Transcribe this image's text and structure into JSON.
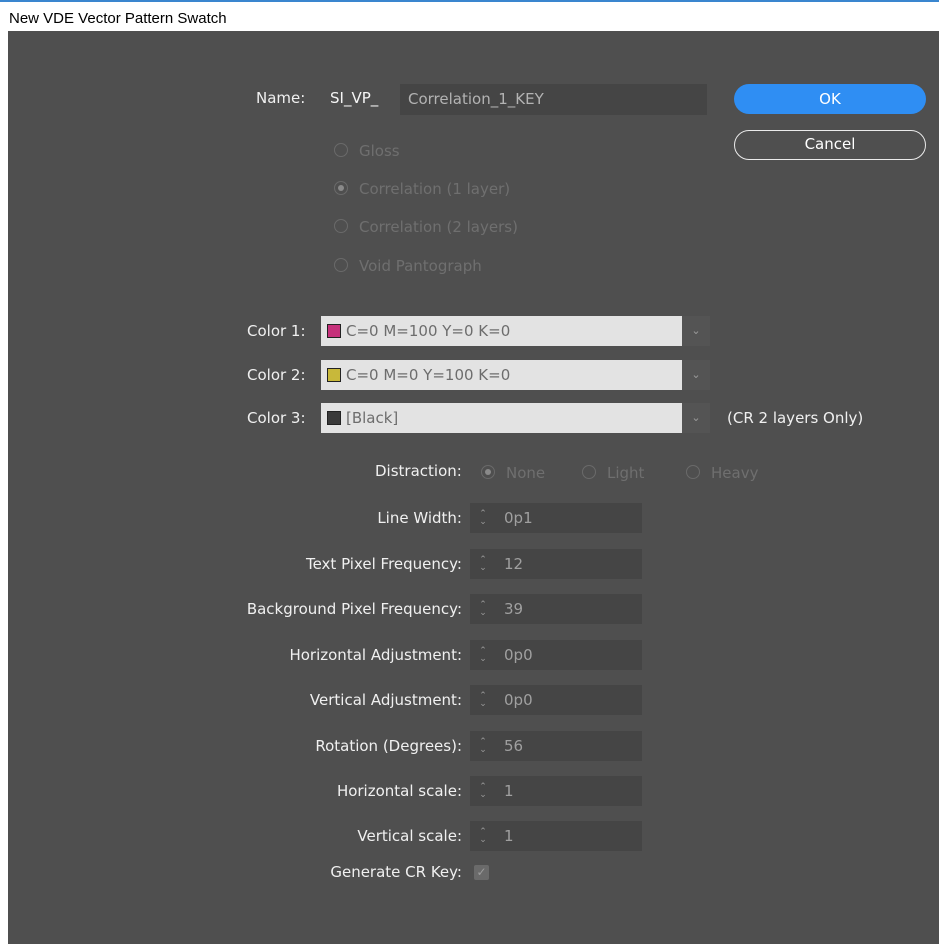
{
  "window": {
    "title": "New VDE Vector Pattern Swatch"
  },
  "name": {
    "label": "Name:",
    "prefix": "SI_VP_",
    "value": "Correlation_1_KEY"
  },
  "buttons": {
    "ok": "OK",
    "cancel": "Cancel"
  },
  "pattern_types": [
    {
      "label": "Gloss",
      "selected": false
    },
    {
      "label": "Correlation (1 layer)",
      "selected": true
    },
    {
      "label": "Correlation (2 layers)",
      "selected": false
    },
    {
      "label": "Void Pantograph",
      "selected": false
    }
  ],
  "colors": [
    {
      "label": "Color 1:",
      "value": "C=0 M=100 Y=0 K=0",
      "swatch": "#c6317b"
    },
    {
      "label": "Color 2:",
      "value": "C=0 M=0 Y=100 K=0",
      "swatch": "#c8b83a"
    },
    {
      "label": "Color 3:",
      "value": "[Black]",
      "swatch": "#3a3a3a",
      "note": "(CR 2 layers Only)"
    }
  ],
  "distraction": {
    "label": "Distraction:",
    "options": [
      {
        "label": "None",
        "selected": true
      },
      {
        "label": "Light",
        "selected": false
      },
      {
        "label": "Heavy",
        "selected": false
      }
    ]
  },
  "fields": [
    {
      "label": "Line Width:",
      "value": "0p1"
    },
    {
      "label": "Text Pixel Frequency:",
      "value": "12"
    },
    {
      "label": "Background Pixel Frequency:",
      "value": "39"
    },
    {
      "label": "Horizontal Adjustment:",
      "value": "0p0"
    },
    {
      "label": "Vertical Adjustment:",
      "value": "0p0"
    },
    {
      "label": "Rotation (Degrees):",
      "value": "56"
    },
    {
      "label": "Horizontal scale:",
      "value": "1"
    },
    {
      "label": "Vertical scale:",
      "value": "1"
    }
  ],
  "generate_key": {
    "label": "Generate CR Key:",
    "checked": true
  },
  "icons": {
    "spinner": "up-down-arrows-icon",
    "dropdown": "chevron-down-icon",
    "check": "checkmark-icon"
  },
  "theme": {
    "accent": "#2f8ef3",
    "panel": "#4f4f4f"
  }
}
